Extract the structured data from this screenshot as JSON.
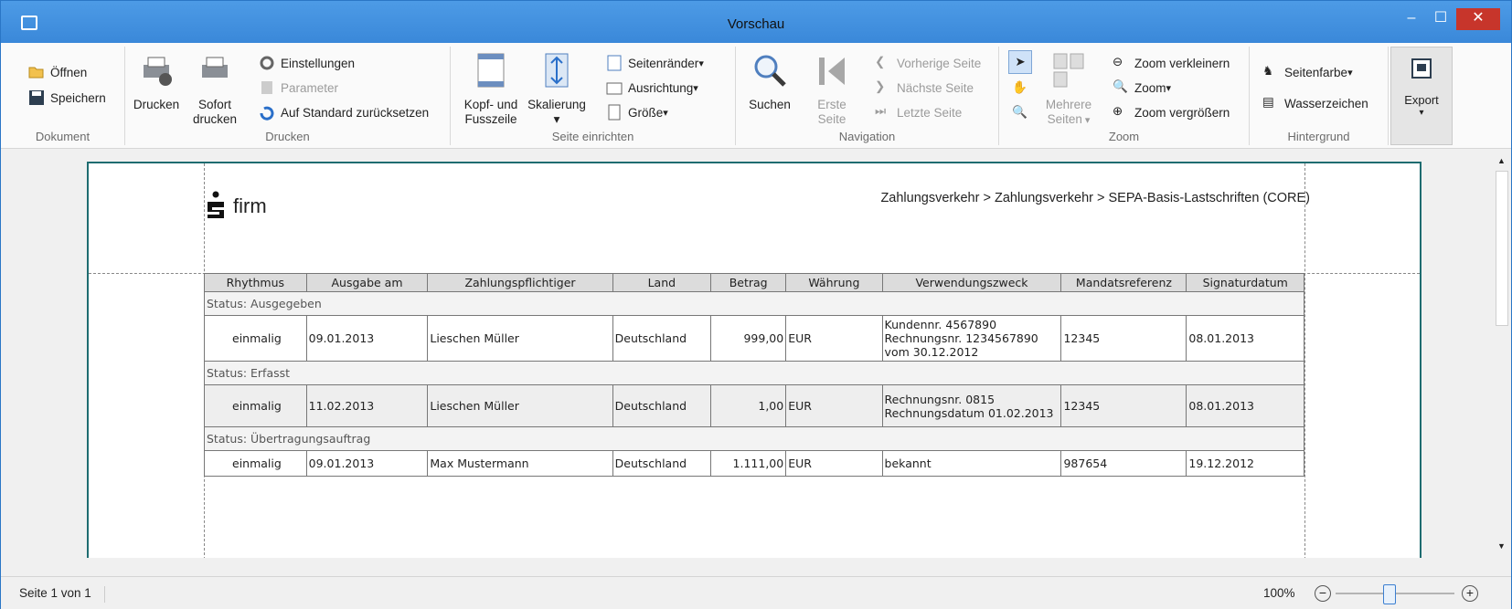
{
  "window": {
    "title": "Vorschau"
  },
  "ribbon": {
    "dokument": {
      "label": "Dokument",
      "open": "Öffnen",
      "save": "Speichern"
    },
    "drucken": {
      "label": "Drucken",
      "print": "Drucken",
      "print_now_1": "Sofort",
      "print_now_2": "drucken",
      "settings": "Einstellungen",
      "parameter": "Parameter",
      "reset": "Auf Standard zurücksetzen"
    },
    "seite": {
      "label": "Seite einrichten",
      "header_footer_1": "Kopf- und",
      "header_footer_2": "Fusszeile",
      "scaling": "Skalierung",
      "margins": "Seitenränder",
      "orientation": "Ausrichtung",
      "size": "Größe"
    },
    "navigation": {
      "label": "Navigation",
      "search": "Suchen",
      "first_1": "Erste",
      "first_2": "Seite",
      "prev": "Vorherige Seite",
      "next": "Nächste Seite",
      "last": "Letzte Seite"
    },
    "zoom": {
      "label": "Zoom",
      "multi_1": "Mehrere",
      "multi_2": "Seiten",
      "zoom_out": "Zoom verkleinern",
      "zoom": "Zoom",
      "zoom_in": "Zoom vergrößern"
    },
    "hintergrund": {
      "label": "Hintergrund",
      "page_color": "Seitenfarbe",
      "watermark": "Wasserzeichen"
    },
    "export": {
      "label": "Export"
    }
  },
  "report": {
    "logo_text": "firm",
    "breadcrumb": "Zahlungsverkehr > Zahlungsverkehr > SEPA-Basis-Lastschriften (CORE)",
    "columns": [
      "Rhythmus",
      "Ausgabe am",
      "Zahlungspflichtiger",
      "Land",
      "Betrag",
      "Währung",
      "Verwendungszweck",
      "Mandatsreferenz",
      "Signaturdatum"
    ],
    "groups": [
      {
        "status": "Status: Ausgegeben",
        "rows": [
          [
            "einmalig",
            "09.01.2013",
            "Lieschen Müller",
            "Deutschland",
            "999,00",
            "EUR",
            "Kundennr. 4567890\nRechnungsnr. 1234567890\nvom 30.12.2012",
            "12345",
            "08.01.2013"
          ]
        ]
      },
      {
        "status": "Status: Erfasst",
        "rows": [
          [
            "einmalig",
            "11.02.2013",
            "Lieschen Müller",
            "Deutschland",
            "1,00",
            "EUR",
            "Rechnungsnr. 0815\nRechnungsdatum 01.02.2013",
            "12345",
            "08.01.2013"
          ]
        ]
      },
      {
        "status": "Status: Übertragungsauftrag",
        "rows": [
          [
            "einmalig",
            "09.01.2013",
            "Max Mustermann",
            "Deutschland",
            "1.111,00",
            "EUR",
            "bekannt",
            "987654",
            "19.12.2012"
          ]
        ]
      }
    ]
  },
  "statusbar": {
    "page_info": "Seite 1 von 1",
    "zoom_level": "100%",
    "zoom_fraction": 0.45
  }
}
